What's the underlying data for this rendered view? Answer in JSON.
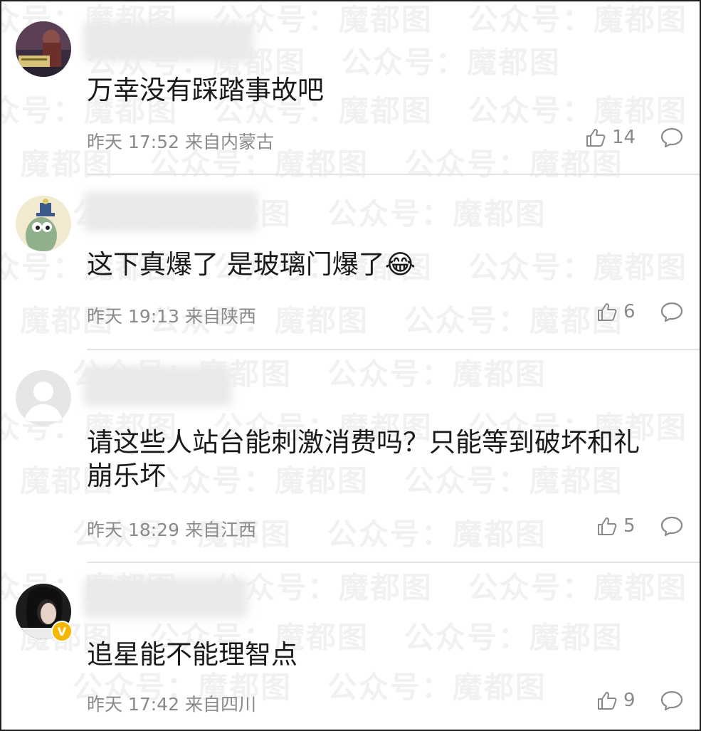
{
  "watermark": "公众号：魔都图",
  "comments": [
    {
      "text": "万幸没有踩踏事故吧",
      "time": "昨天 17:52",
      "location": "来自内蒙古",
      "likes": "14"
    },
    {
      "text": "这下真爆了 是玻璃门爆了😂",
      "time": "昨天 19:13",
      "location": "来自陕西",
      "likes": "6"
    },
    {
      "text_line1": "请这些人站台能刺激消费吗？只能等到破坏和礼",
      "text_line2": "崩乐坏",
      "time": "昨天 18:29",
      "location": "来自江西",
      "likes": "5"
    },
    {
      "text": "追星能不能理智点",
      "time": "昨天 17:42",
      "location": "来自四川",
      "likes": "9",
      "badge": "V"
    }
  ],
  "icons": {
    "like": "thumbs-up-icon",
    "reply": "comment-bubble-icon"
  }
}
